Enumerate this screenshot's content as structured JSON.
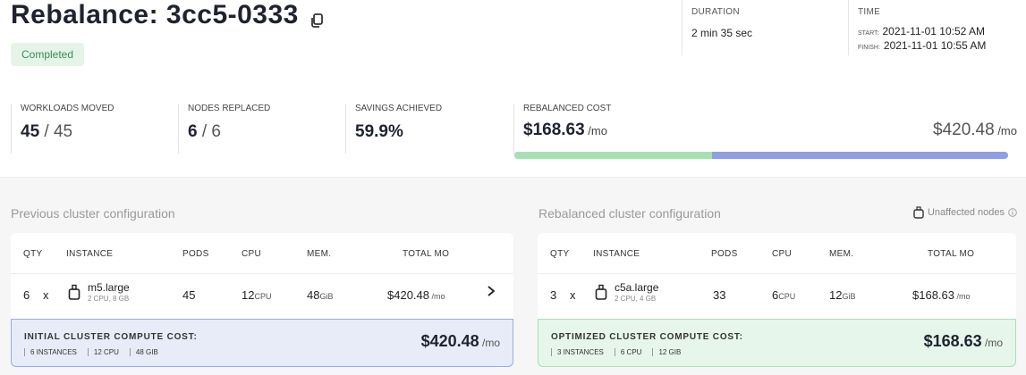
{
  "header": {
    "title": "Rebalance: 3cc5-0333",
    "status": "Completed",
    "duration_label": "DURATION",
    "duration_value": "2 min 35 sec",
    "time_label": "TIME",
    "start_label": "START:",
    "start_value": "2021-11-01 10:52 AM",
    "finish_label": "FINISH:",
    "finish_value": "2021-11-01 10:55 AM"
  },
  "stats": {
    "workloads_label": "WORKLOADS MOVED",
    "workloads_value": "45",
    "workloads_total": " / 45",
    "nodes_label": "NODES REPLACED",
    "nodes_value": "6",
    "nodes_total": " / 6",
    "savings_label": "SAVINGS ACHIEVED",
    "savings_value": "59.9%",
    "cost_label": "REBALANCED COST",
    "cost_new": "$168.63",
    "cost_old": "$420.48",
    "per_mo": " /mo",
    "cost_fraction": 0.401
  },
  "columns": {
    "qty": "QTY",
    "instance": "INSTANCE",
    "pods": "PODS",
    "cpu": "CPU",
    "mem": "MEM.",
    "total": "TOTAL MO"
  },
  "previous": {
    "title": "Previous cluster configuration",
    "row": {
      "qty": "6",
      "x": "x",
      "instance": "m5.large",
      "spec": "2 CPU, 8 GB",
      "pods": "45",
      "cpu": "12",
      "cpu_unit": "CPU",
      "mem": "48",
      "mem_unit": "GiB",
      "total": "$420.48",
      "total_unit": " /mo"
    },
    "summary_label": "INITIAL CLUSTER COMPUTE COST:",
    "chips": [
      "6 INSTANCES",
      "12 CPU",
      "48 GiB"
    ],
    "summary_cost": "$420.48",
    "summary_unit": " /mo"
  },
  "rebalanced": {
    "title": "Rebalanced cluster configuration",
    "unaffected": "Unaffected nodes",
    "row": {
      "qty": "3",
      "x": "x",
      "instance": "c5a.large",
      "spec": "2 CPU, 4 GB",
      "pods": "33",
      "cpu": "6",
      "cpu_unit": "CPU",
      "mem": "12",
      "mem_unit": "GiB",
      "total": "$168.63",
      "total_unit": " /mo"
    },
    "summary_label": "OPTIMIZED CLUSTER COMPUTE COST:",
    "chips": [
      "3 INSTANCES",
      "6 CPU",
      "12 GiB"
    ],
    "summary_cost": "$168.63",
    "summary_unit": " /mo"
  },
  "colors": {
    "green_bar": "#a9e0b3",
    "blue_bar": "#8e9fe2"
  }
}
